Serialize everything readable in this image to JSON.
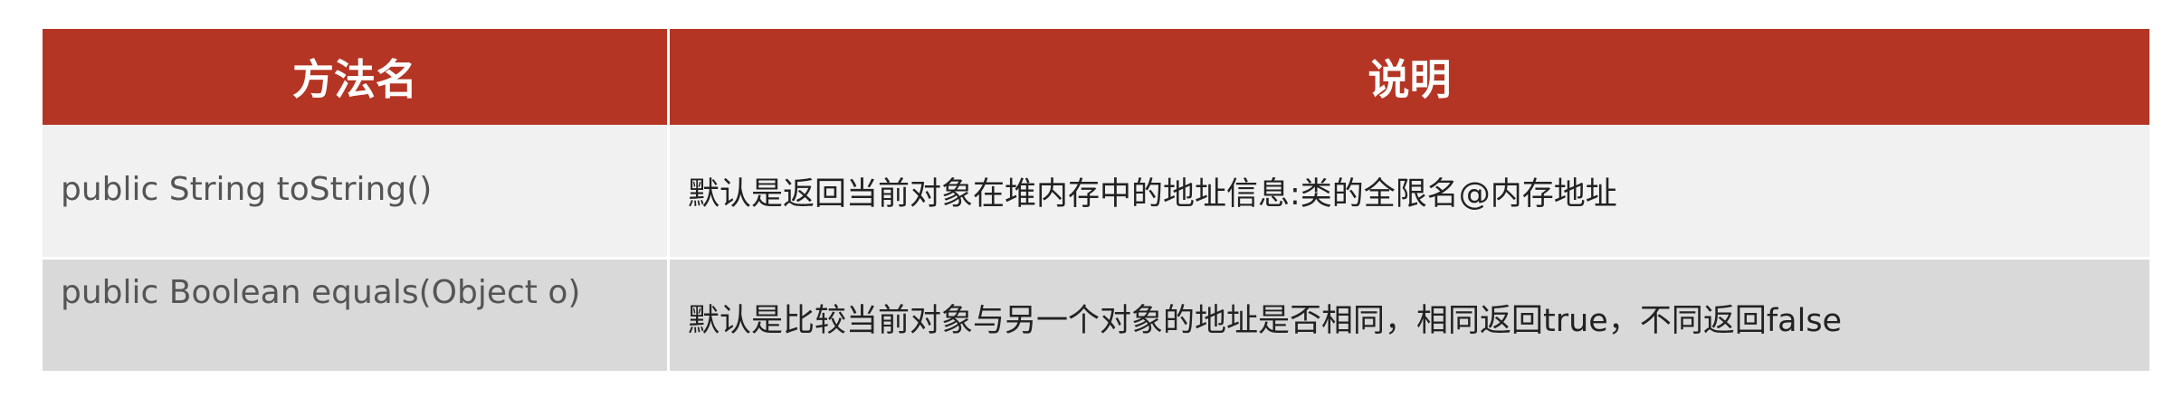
{
  "table": {
    "headers": [
      "方法名",
      "说明"
    ],
    "rows": [
      {
        "method": "public String toString()",
        "description": "默认是返回当前对象在堆内存中的地址信息:类的全限名@内存地址"
      },
      {
        "method": "public Boolean equals(Object o)",
        "description": "默认是比较当前对象与另一个对象的地址是否相同，相同返回true，不同返回false"
      }
    ]
  },
  "colors": {
    "header_bg": "#b53524",
    "header_text": "#ffffff",
    "row1_bg": "#f1f1f1",
    "row2_bg": "#d9d9d9"
  }
}
